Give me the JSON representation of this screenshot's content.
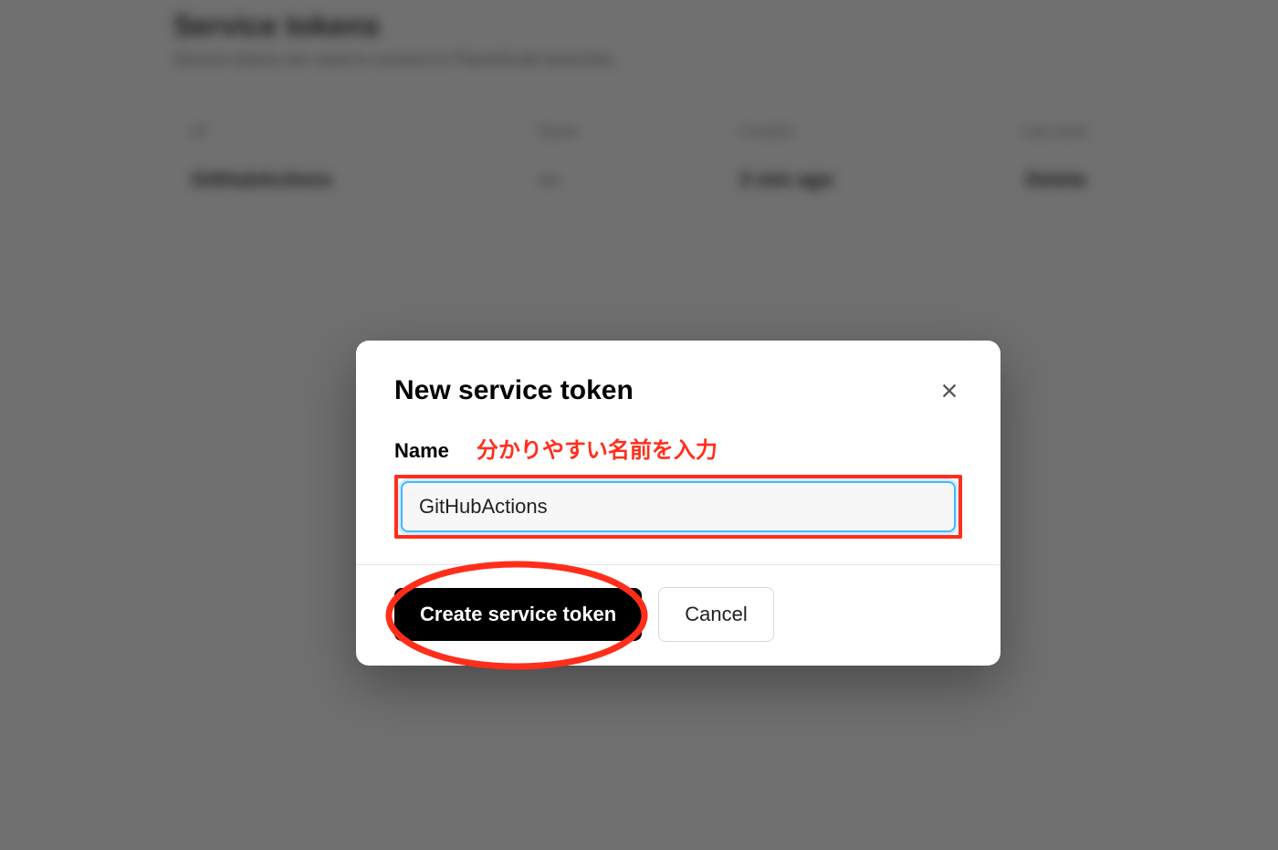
{
  "background": {
    "title": "Service tokens",
    "subtitle": "Service tokens are used to connect to PlanetScale branches.",
    "table": {
      "headers": [
        "ID",
        "Name",
        "Created"
      ],
      "row": {
        "name": "GitHubActions",
        "id": "—",
        "created": "3 min ago"
      }
    }
  },
  "modal": {
    "title": "New service token",
    "nameLabel": "Name",
    "nameValue": "GitHubActions",
    "createButton": "Create service token",
    "cancelButton": "Cancel"
  },
  "annotations": {
    "nameHint": "分かりやすい名前を入力"
  }
}
